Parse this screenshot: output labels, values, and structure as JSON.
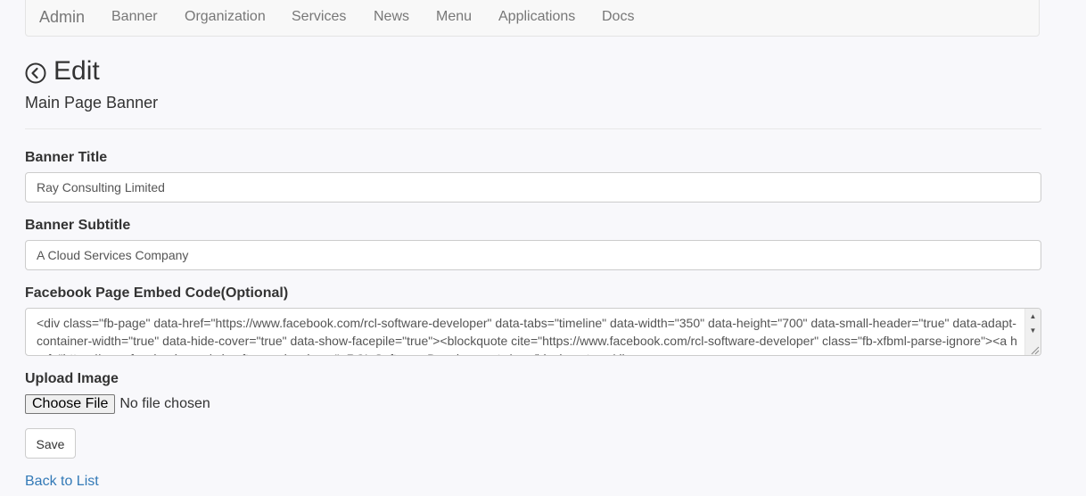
{
  "nav": {
    "brand": "Admin",
    "items": [
      "Banner",
      "Organization",
      "Services",
      "News",
      "Menu",
      "Applications",
      "Docs"
    ]
  },
  "page": {
    "title": "Edit",
    "subtitle": "Main Page Banner",
    "back_icon": "circle-chevron-left-icon"
  },
  "form": {
    "banner_title": {
      "label": "Banner Title",
      "value": "Ray Consulting Limited"
    },
    "banner_subtitle": {
      "label": "Banner Subtitle",
      "value": "A Cloud Services Company"
    },
    "facebook_embed": {
      "label": "Facebook Page Embed Code(Optional)",
      "value": "<div class=\"fb-page\" data-href=\"https://www.facebook.com/rcl-software-developer\" data-tabs=\"timeline\" data-width=\"350\" data-height=\"700\" data-small-header=\"true\" data-adapt-container-width=\"true\" data-hide-cover=\"true\" data-show-facepile=\"true\"><blockquote cite=\"https://www.facebook.com/rcl-software-developer\" class=\"fb-xfbml-parse-ignore\"><a href=\"https://www.facebook.com/rcl-software-developer\">RCL Software Development</a></blockquote></div>"
    },
    "upload": {
      "label": "Upload Image",
      "button_label": "Choose File",
      "status": "No file chosen"
    },
    "save_label": "Save",
    "back_link": "Back to List"
  },
  "colors": {
    "link": "#337ab7",
    "text": "#333333",
    "nav_text": "#777777",
    "background": "#f8f8fb"
  }
}
